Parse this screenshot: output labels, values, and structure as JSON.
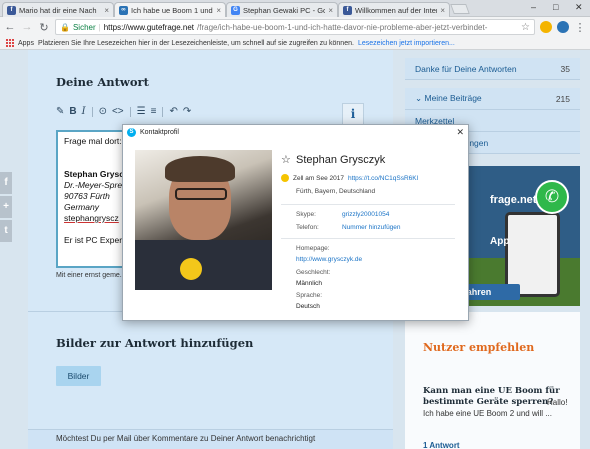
{
  "browser": {
    "tabs": [
      {
        "label": "Mario hat dir eine Nach",
        "favicon_color": "#3b5998",
        "favicon_letter": "f"
      },
      {
        "label": "Ich habe ue Boom 1 und",
        "favicon_color": "#2b73b5",
        "favicon_letter": "∞"
      },
      {
        "label": "Stephan Gewaki PC - Go",
        "favicon_color": "#4285f4",
        "favicon_letter": "G"
      },
      {
        "label": "Willkommen auf der Inter",
        "favicon_color": "#3b5998",
        "favicon_letter": "f"
      }
    ],
    "window_buttons": [
      "–",
      "□",
      "✕"
    ],
    "address": {
      "secure_label": "Sicher",
      "host": "https://www.gutefrage.net",
      "path": "/frage/ich-habe-ue-boom-1-und-ich-hatte-davor-nie-probleme-aber-jetzt-verbindet-"
    },
    "bookmarks": {
      "apps_label": "Apps",
      "text": "Platzieren Sie Ihre Lesezeichen hier in der Lesezeichenleiste, um schnell auf sie zugreifen zu können.",
      "link": "Lesezeichen jetzt importieren..."
    }
  },
  "main": {
    "answer_title": "Deine Antwort",
    "toolbar": [
      "✎",
      "B",
      "I",
      "⊙",
      "<>",
      "☰",
      "≡",
      "↶",
      "↷"
    ],
    "info_label": "i",
    "editor_lines": [
      {
        "text": "Frage mal dort:",
        "style": ""
      },
      {
        "text": "",
        "style": ""
      },
      {
        "text": "",
        "style": ""
      },
      {
        "text": "Stephan Grysc",
        "style": "bold"
      },
      {
        "text": "Dr.-Meyer-Spre",
        "style": "it"
      },
      {
        "text": "90763 Fürth",
        "style": "it"
      },
      {
        "text": "Germany",
        "style": "it"
      },
      {
        "text": "stephangryscz",
        "style": "link"
      },
      {
        "text": "",
        "style": ""
      },
      {
        "text": "Er ist PC Exper",
        "style": ""
      }
    ],
    "hint": "Mit einer ernst geme... vielen Menschen we...",
    "bilder_title": "Bilder zur Antwort hinzufügen",
    "bilder_button": "Bilder",
    "mail_line": "Möchtest Du per Mail über Kommentare zu Deiner Antwort benachrichtigt"
  },
  "sidebar": {
    "rows": [
      {
        "label": "Danke für Deine Antworten",
        "count": "35"
      },
      {
        "label": "⌄  Meine Beiträge",
        "count": "215"
      },
      {
        "label": "Merkzettel",
        "count": ""
      },
      {
        "label": "Profil-Einstellungen",
        "count": ""
      }
    ],
    "ad": {
      "brand": "frage.net",
      "app": "App",
      "cta": "fahren"
    },
    "nutzer_title": "Nutzer empfehlen",
    "question_title": "Kann man eine UE Boom für bestimmte Geräte sperren?",
    "question_link": "Hallo!",
    "question_body": "Ich habe eine UE Boom 2 und will ...",
    "answer_count": "1 Antwort"
  },
  "popup": {
    "title": "Kontaktprofil",
    "name": "Stephan Grysczyk",
    "mood_text": "Zell am See 2017",
    "mood_link": "https://t.co/NC1qSsR6Kl",
    "location": "Fürth, Bayern, Deutschland",
    "skype_label": "Skype:",
    "skype_value": "grizzly20001054",
    "phone_label": "Telefon:",
    "phone_value": "Nummer hinzufügen",
    "homepage_label": "Homepage:",
    "homepage_value": "http://www.grysczyk.de",
    "gender_label": "Geschlecht:",
    "gender_value": "Männlich",
    "language_label": "Sprache:",
    "language_value": "Deutsch"
  }
}
